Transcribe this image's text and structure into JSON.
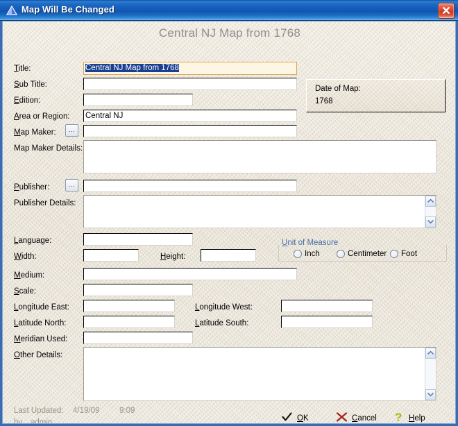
{
  "window": {
    "title": "Map Will Be Changed",
    "icon": "warning-triangle-icon",
    "close_label": "×"
  },
  "header": {
    "title": "Central NJ Map from 1768"
  },
  "fields": {
    "title": {
      "label": "Title:",
      "accel": "T",
      "value": "Central NJ Map from 1768",
      "focused": true
    },
    "sub_title": {
      "label": "Sub Title:",
      "accel": "S",
      "value": ""
    },
    "edition": {
      "label": "Edition:",
      "accel": "E",
      "value": ""
    },
    "area_or_region": {
      "label": "Area or Region:",
      "accel": "A",
      "value": "Central NJ"
    },
    "map_maker": {
      "label": "Map Maker:",
      "accel": "M",
      "value": "",
      "browse_label": "..."
    },
    "map_maker_details": {
      "label": "Map Maker Details:",
      "value": ""
    },
    "publisher": {
      "label": "Publisher:",
      "accel": "P",
      "value": "",
      "browse_label": "..."
    },
    "publisher_details": {
      "label": "Publisher Details:",
      "value": ""
    },
    "language": {
      "label": "Language:",
      "accel": "L",
      "value": ""
    },
    "width": {
      "label": "Width:",
      "accel": "W",
      "value": ""
    },
    "height": {
      "label": "Height:",
      "accel": "H",
      "value": ""
    },
    "medium": {
      "label": "Medium:",
      "accel": "M",
      "value": ""
    },
    "scale": {
      "label": "Scale:",
      "accel": "S",
      "value": ""
    },
    "longitude_east": {
      "label": "Longitude East:",
      "accel": "L",
      "value": ""
    },
    "longitude_west": {
      "label": "Longitude West:",
      "accel": "L",
      "value": ""
    },
    "latitude_north": {
      "label": "Latitude North:",
      "accel": "L",
      "value": ""
    },
    "latitude_south": {
      "label": "Latitude South:",
      "accel": "L",
      "value": ""
    },
    "meridian_used": {
      "label": "Meridian Used:",
      "accel": "M",
      "value": ""
    },
    "other_details": {
      "label": "Other Details:",
      "accel": "O",
      "value": ""
    }
  },
  "date_of_map": {
    "label": "Date of Map:",
    "value": "1768"
  },
  "unit_of_measure": {
    "legend": "Unit of Measure",
    "accel": "U",
    "options": [
      {
        "label": "Inch",
        "selected": false
      },
      {
        "label": "Centimeter",
        "selected": false
      },
      {
        "label": "Foot",
        "selected": false
      }
    ]
  },
  "footer": {
    "last_updated_label": "Last Updated:",
    "last_updated_date": "4/19/09",
    "last_updated_time": "9:09",
    "by_label": "by",
    "by_user": "admin",
    "ok_label": "OK",
    "ok_accel": "O",
    "cancel_label": "Cancel",
    "cancel_accel": "C",
    "help_label": "Help",
    "help_accel": "H"
  },
  "colors": {
    "titlebar_blue": "#1157b2",
    "close_red": "#cf3c1f",
    "focus_border": "#e0a050",
    "selection_blue": "#1b3f8f",
    "group_legend_blue": "#4a6fa5",
    "header_gray": "#8e8e8e",
    "cancel_x_red": "#b02020",
    "help_question_olive": "#a8a80c"
  }
}
